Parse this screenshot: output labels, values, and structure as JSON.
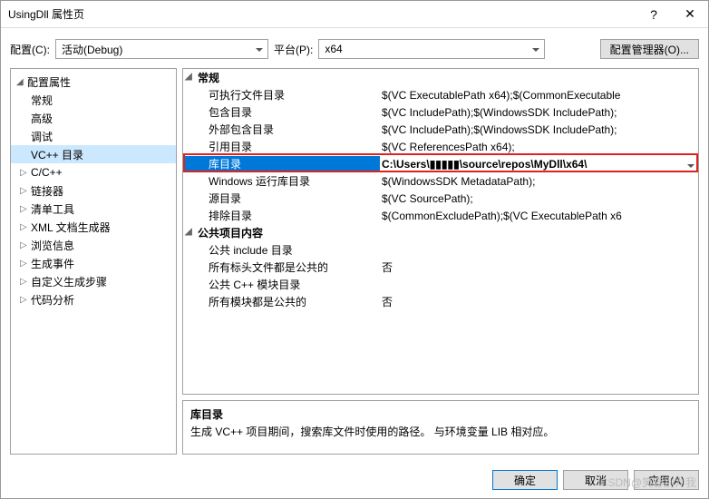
{
  "title": "UsingDll 属性页",
  "toolbar": {
    "config_label": "配置(C):",
    "config_value": "活动(Debug)",
    "platform_label": "平台(P):",
    "platform_value": "x64",
    "config_mgr": "配置管理器(O)..."
  },
  "tree": {
    "root": "配置属性",
    "items": [
      {
        "label": "常规",
        "exp": false
      },
      {
        "label": "高级",
        "exp": false
      },
      {
        "label": "调试",
        "exp": false
      },
      {
        "label": "VC++ 目录",
        "exp": false,
        "selected": true
      },
      {
        "label": "C/C++",
        "exp": true
      },
      {
        "label": "链接器",
        "exp": true
      },
      {
        "label": "清单工具",
        "exp": true
      },
      {
        "label": "XML 文档生成器",
        "exp": true
      },
      {
        "label": "浏览信息",
        "exp": true
      },
      {
        "label": "生成事件",
        "exp": true
      },
      {
        "label": "自定义生成步骤",
        "exp": true
      },
      {
        "label": "代码分析",
        "exp": true
      }
    ]
  },
  "grid": {
    "groups": [
      {
        "label": "常规",
        "rows": [
          {
            "name": "可执行文件目录",
            "value": "$(VC ExecutablePath x64);$(CommonExecutable"
          },
          {
            "name": "包含目录",
            "value": "$(VC IncludePath);$(WindowsSDK IncludePath);"
          },
          {
            "name": "外部包含目录",
            "value": "$(VC IncludePath);$(WindowsSDK IncludePath);"
          },
          {
            "name": "引用目录",
            "value": "$(VC ReferencesPath x64);"
          },
          {
            "name": "库目录",
            "value": "C:\\Users\\▮▮▮▮▮\\source\\repos\\MyDll\\x64\\",
            "selected": true
          },
          {
            "name": "Windows 运行库目录",
            "value": "$(WindowsSDK MetadataPath);"
          },
          {
            "name": "源目录",
            "value": "$(VC SourcePath);"
          },
          {
            "name": "排除目录",
            "value": "$(CommonExcludePath);$(VC ExecutablePath x6"
          }
        ]
      },
      {
        "label": "公共项目内容",
        "rows": [
          {
            "name": "公共 include 目录",
            "value": ""
          },
          {
            "name": "所有标头文件都是公共的",
            "value": "否"
          },
          {
            "name": "公共 C++ 模块目录",
            "value": ""
          },
          {
            "name": "所有模块都是公共的",
            "value": "否"
          }
        ]
      }
    ]
  },
  "desc": {
    "name": "库目录",
    "text": "生成 VC++ 项目期间，搜索库文件时使用的路径。  与环境变量 LIB 相对应。"
  },
  "buttons": {
    "ok": "确定",
    "cancel": "取消",
    "apply": "应用(A)"
  },
  "watermark": "CSDN@笑容别为我"
}
